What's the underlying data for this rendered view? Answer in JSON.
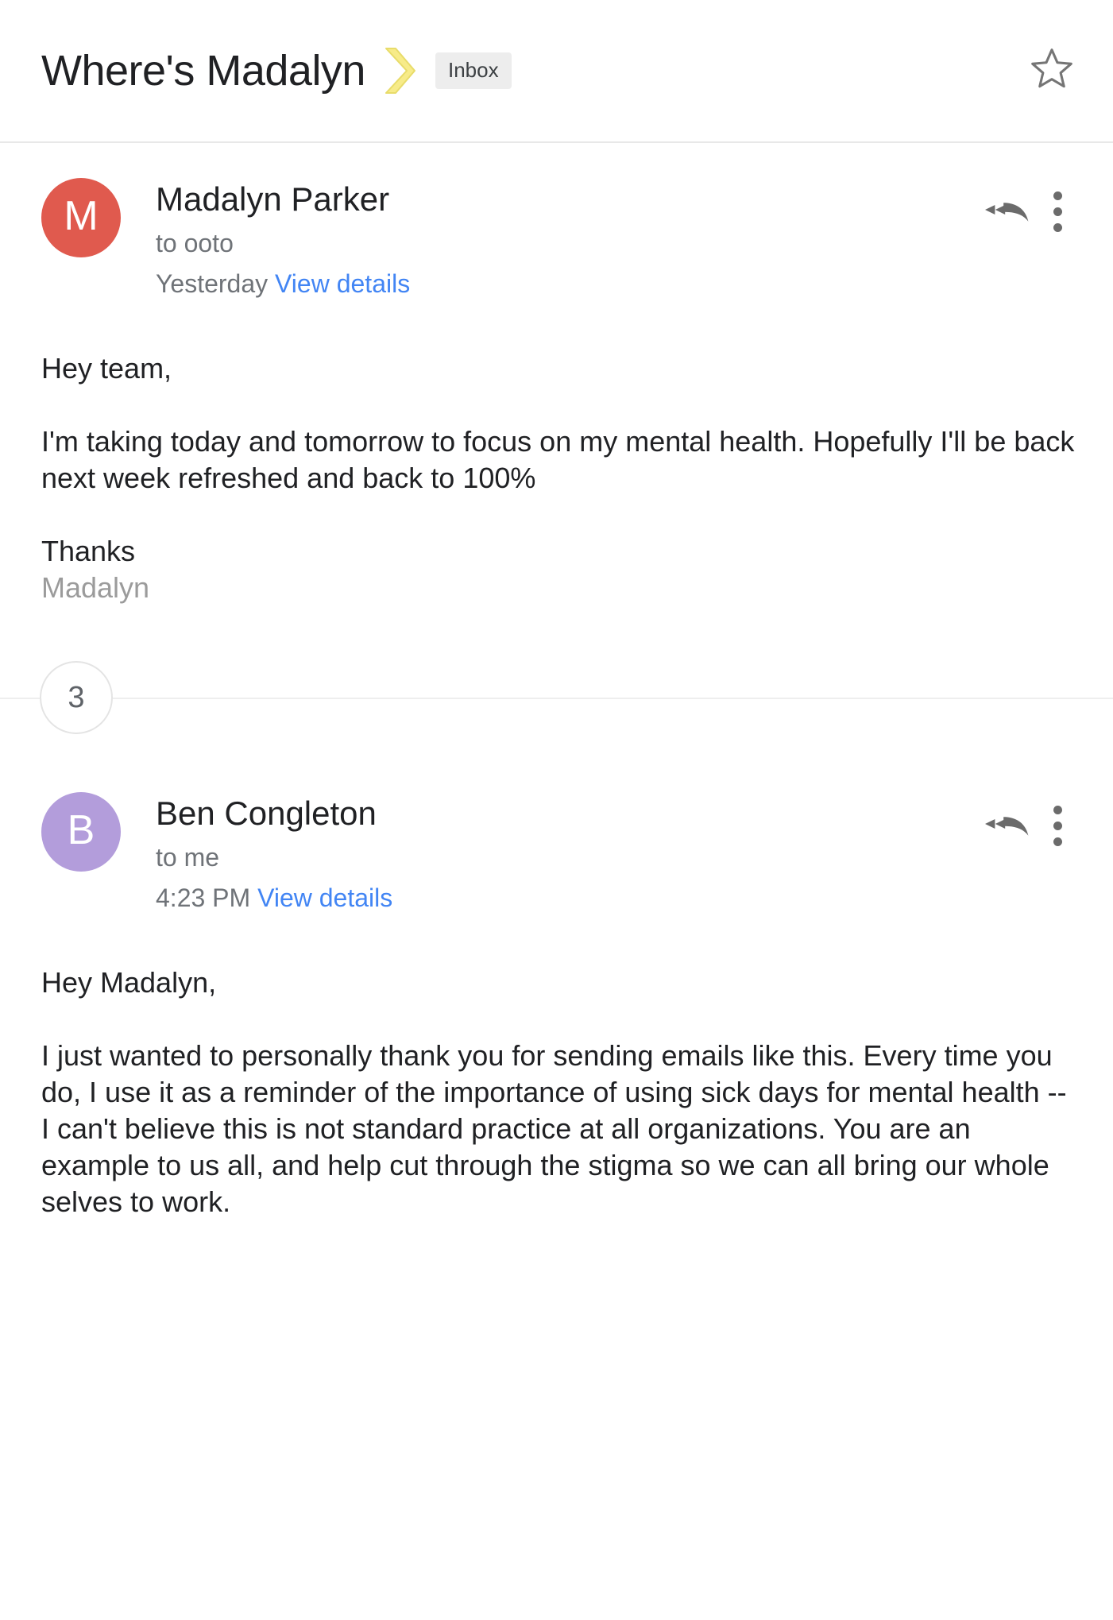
{
  "header": {
    "subject": "Where's Madalyn",
    "chevron_icon": "yellow-chevron-label-icon",
    "label_chip": "Inbox",
    "star_icon": "star-outline-icon"
  },
  "thread": {
    "collapsed_count": "3",
    "messages": [
      {
        "avatar_letter": "M",
        "avatar_color": "#e05a4e",
        "sender": "Madalyn Parker",
        "recipient": "to ooto",
        "timestamp": "Yesterday",
        "details_link": "View details",
        "reply_all_icon": "reply-all-icon",
        "more_icon": "more-vertical-icon",
        "body": {
          "greeting": "Hey team,",
          "paragraph": "I'm taking today and tomorrow to focus on my mental health. Hopefully I'll be back next week refreshed and back to 100%",
          "signoff": "Thanks",
          "signature": "Madalyn"
        }
      },
      {
        "avatar_letter": "B",
        "avatar_color": "#b39ddb",
        "sender": "Ben Congleton",
        "recipient": "to me",
        "timestamp": "4:23 PM",
        "details_link": "View details",
        "reply_all_icon": "reply-all-icon",
        "more_icon": "more-vertical-icon",
        "body": {
          "greeting": "Hey Madalyn,",
          "paragraph": "I just wanted to personally thank you for sending emails like this.  Every time you do, I use it as a reminder of the importance of using sick days for mental health -- I can't believe this is not standard practice at all organizations.  You are an example to us all, and help cut through the stigma so we can all bring our whole selves to work."
        }
      }
    ]
  },
  "colors": {
    "link": "#4285f4",
    "chevron": "#f7eb89",
    "muted_text": "#6f7378",
    "signature_gray": "#9b9b9b"
  }
}
